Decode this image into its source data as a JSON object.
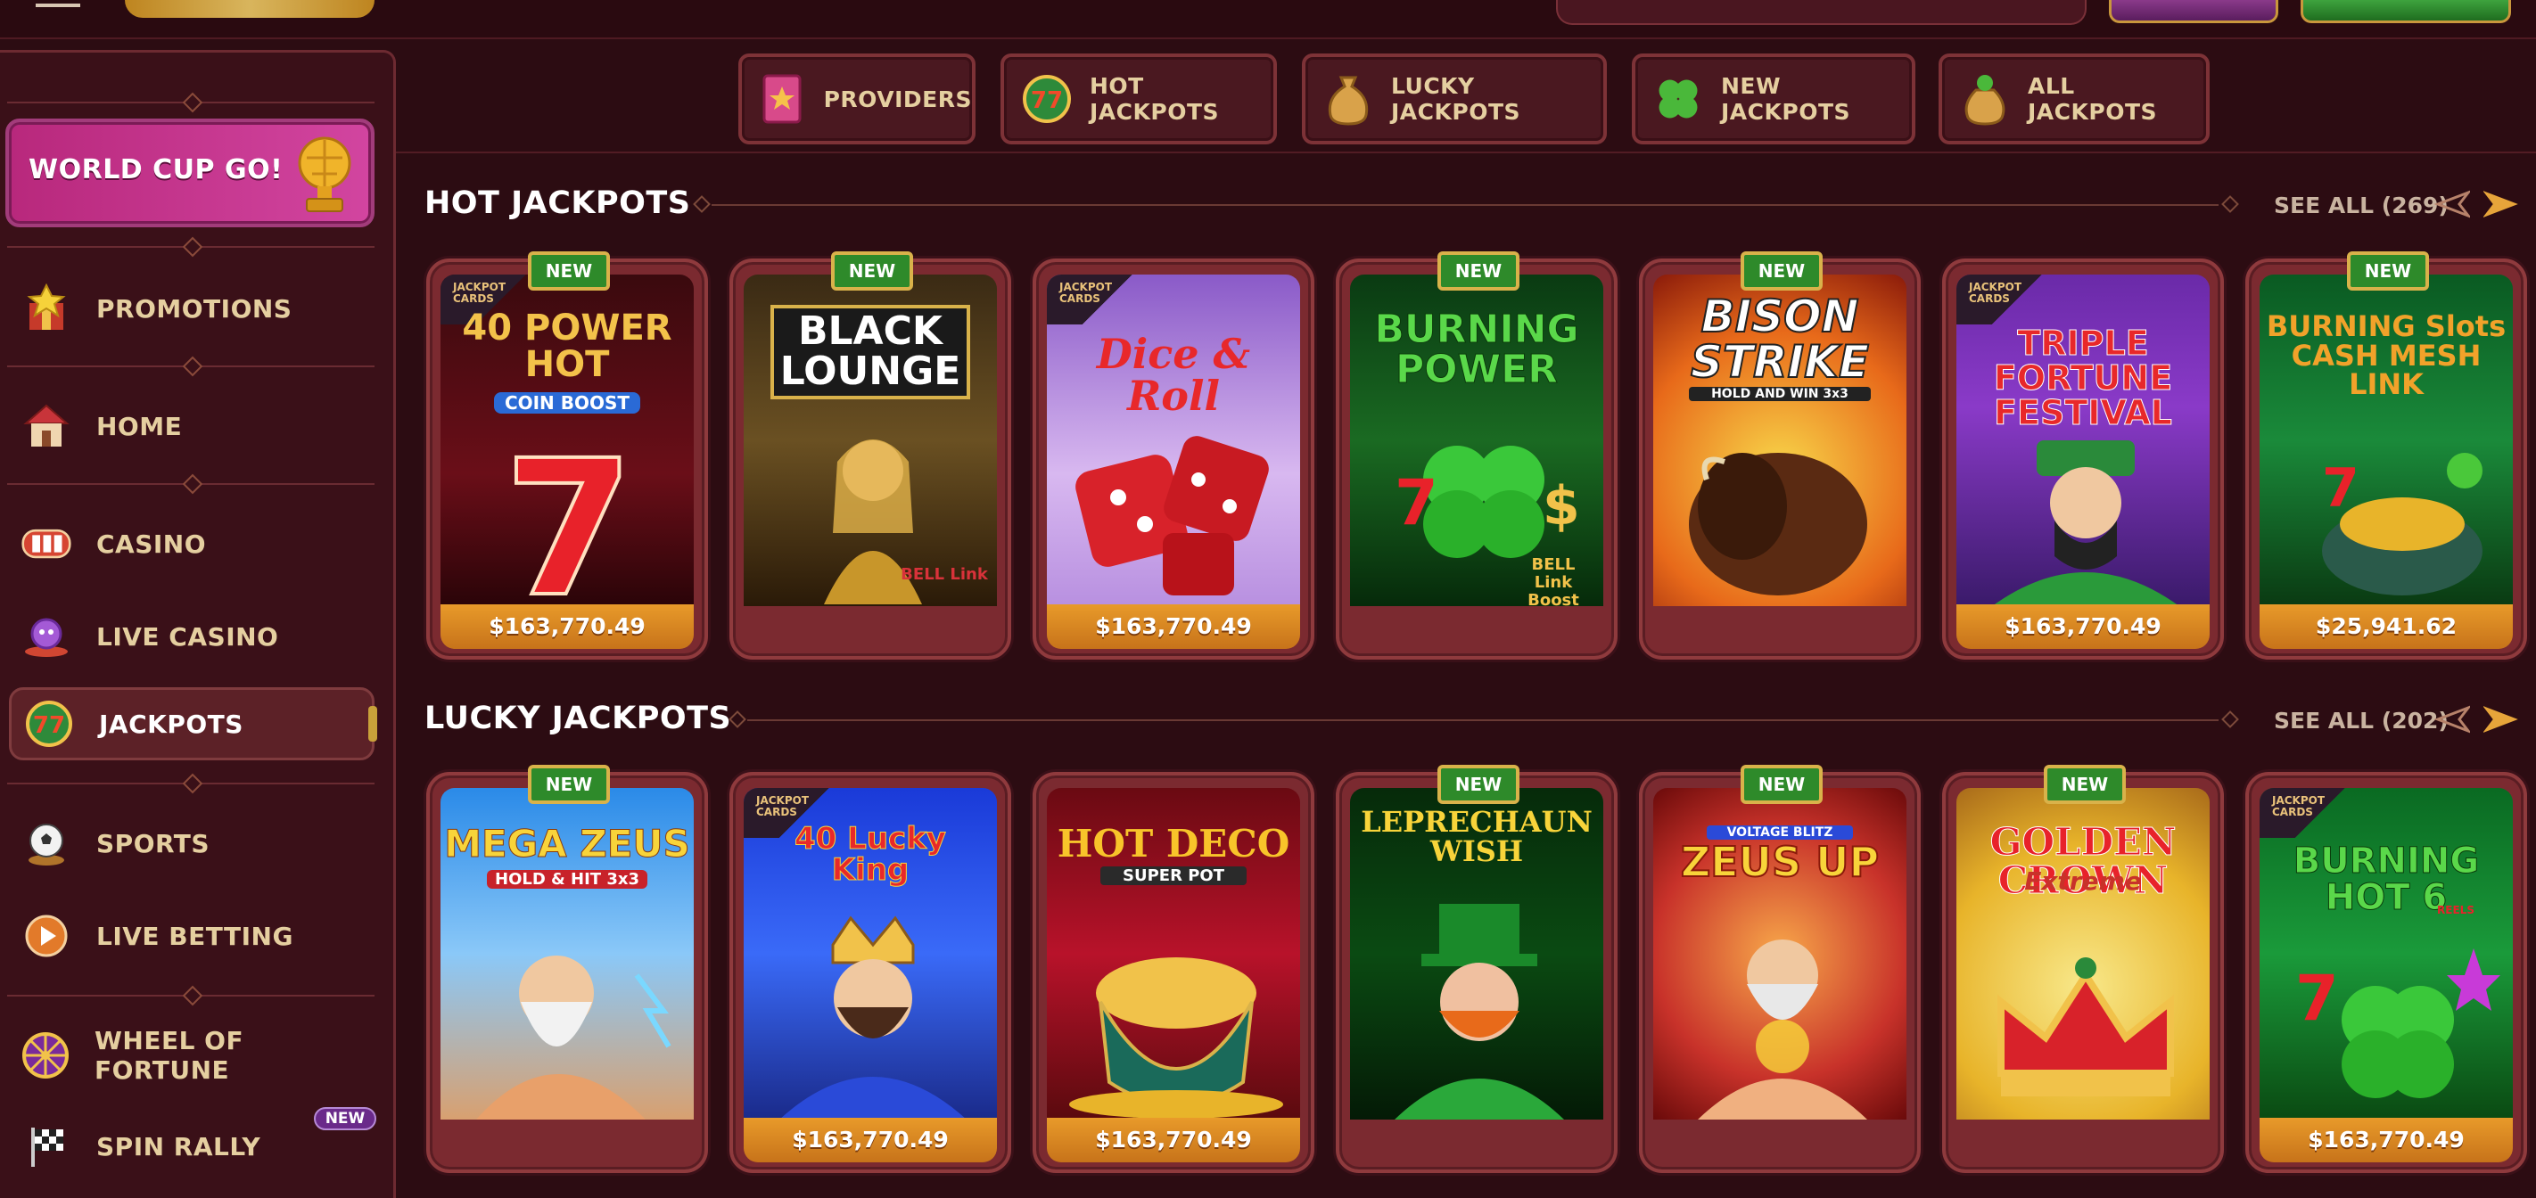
{
  "sidebar": {
    "promo_label": "WORLD CUP GO!",
    "items": [
      {
        "label": "PROMOTIONS",
        "icon": "promotions-icon"
      },
      {
        "label": "HOME",
        "icon": "home-icon"
      },
      {
        "label": "CASINO",
        "icon": "casino-icon"
      },
      {
        "label": "LIVE CASINO",
        "icon": "live-casino-icon"
      },
      {
        "label": "JACKPOTS",
        "icon": "jackpots-icon",
        "active": true
      },
      {
        "label": "SPORTS",
        "icon": "sports-icon"
      },
      {
        "label": "LIVE BETTING",
        "icon": "live-betting-icon"
      },
      {
        "label": "WHEEL OF FORTUNE",
        "icon": "wheel-icon"
      },
      {
        "label": "SPIN RALLY",
        "icon": "flag-icon",
        "badge": "NEW"
      }
    ]
  },
  "categories": [
    {
      "label": "PROVIDERS",
      "icon": "book-icon"
    },
    {
      "label": "HOT JACKPOTS",
      "icon": "seven-icon"
    },
    {
      "label": "LUCKY JACKPOTS",
      "icon": "money-bag-icon"
    },
    {
      "label": "NEW JACKPOTS",
      "icon": "clover-icon"
    },
    {
      "label": "ALL JACKPOTS",
      "icon": "clover-bag-icon"
    }
  ],
  "sections": {
    "hot": {
      "title": "HOT JACKPOTS",
      "see_all": "SEE ALL (269)"
    },
    "lucky": {
      "title": "LUCKY JACKPOTS",
      "see_all": "SEE ALL (202)"
    }
  },
  "badges": {
    "new": "NEW",
    "jackpot_cards": "JACKPOT CARDS"
  },
  "hot_games": [
    {
      "title": "40 POWER HOT",
      "sub": "COIN BOOST",
      "amount": "$163,770.49",
      "new": true,
      "jc": true
    },
    {
      "title": "BLACK LOUNGE",
      "sub": "BELL Link",
      "amount": "",
      "new": true,
      "jc": false
    },
    {
      "title": "Dice & Roll",
      "sub": "",
      "amount": "$163,770.49",
      "new": false,
      "jc": true
    },
    {
      "title": "BURNING POWER",
      "sub": "BELL Link Boost",
      "amount": "",
      "new": true,
      "jc": false
    },
    {
      "title": "BISON STRIKE",
      "sub": "HOLD AND WIN 3x3",
      "amount": "",
      "new": true,
      "jc": false
    },
    {
      "title": "TRIPLE FORTUNE FESTIVAL",
      "sub": "",
      "amount": "$163,770.49",
      "new": false,
      "jc": true
    },
    {
      "title": "BURNING Slots CASH MESH LINK",
      "sub": "",
      "amount": "$25,941.62",
      "new": true,
      "jc": false
    }
  ],
  "lucky_games": [
    {
      "title": "MEGA ZEUS",
      "sub": "HOLD & HIT 3x3",
      "amount": "",
      "new": true,
      "jc": false
    },
    {
      "title": "40 Lucky King",
      "sub": "",
      "amount": "$163,770.49",
      "new": false,
      "jc": true
    },
    {
      "title": "HOT DECO",
      "sub": "SUPER POT",
      "amount": "$163,770.49",
      "new": false,
      "jc": false
    },
    {
      "title": "LEPRECHAUN WISH",
      "sub": "",
      "amount": "",
      "new": true,
      "jc": false
    },
    {
      "title": "ZEUS UP",
      "sub": "VOLTAGE BLITZ",
      "amount": "",
      "new": true,
      "jc": false
    },
    {
      "title": "GOLDEN CROWN",
      "sub": "Extreme",
      "amount": "",
      "new": true,
      "jc": false
    },
    {
      "title": "BURNING HOT 6",
      "sub": "REELS",
      "amount": "$163,770.49",
      "new": false,
      "jc": true
    }
  ]
}
